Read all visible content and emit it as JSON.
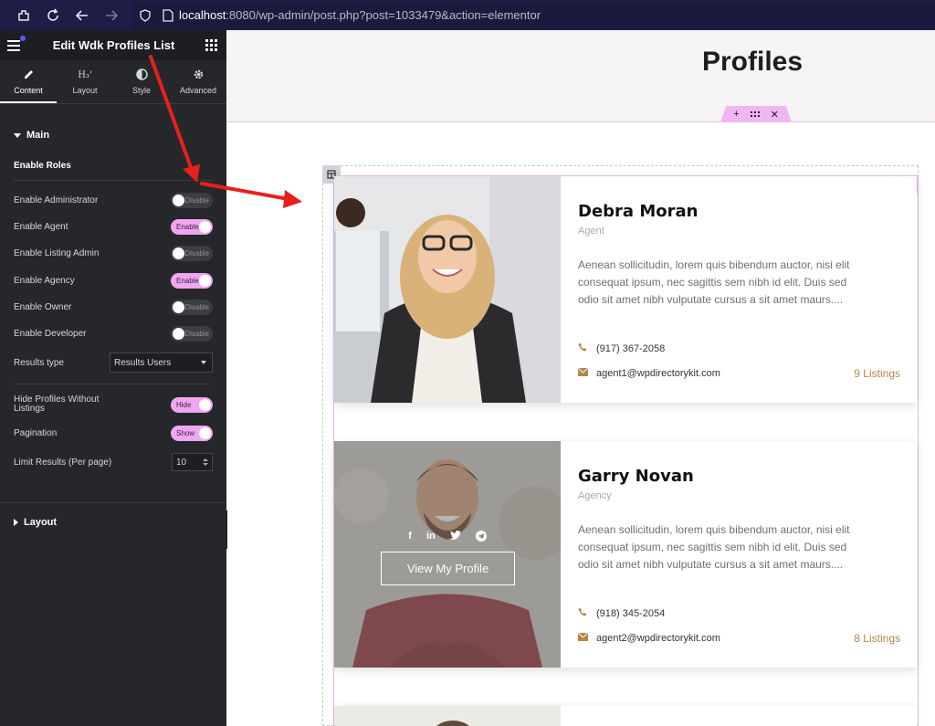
{
  "browser": {
    "url_host": "localhost",
    "url_rest": ":8080/wp-admin/post.php?post=1033479&action=elementor"
  },
  "sidebar": {
    "title": "Edit Wdk Profiles List",
    "tabs": [
      {
        "label": "Content",
        "icon": "pencil-icon"
      },
      {
        "label": "Layout",
        "icon": "layout-icon"
      },
      {
        "label": "Style",
        "icon": "contrast-icon"
      },
      {
        "label": "Advanced",
        "icon": "gear-icon"
      }
    ],
    "layout_tab_glyph": "H₃'",
    "main_section": "Main",
    "enable_roles_heading": "Enable Roles",
    "roles": [
      {
        "label": "Enable Administrator",
        "state": "Disable"
      },
      {
        "label": "Enable Agent",
        "state": "Enable"
      },
      {
        "label": "Enable Listing Admin",
        "state": "Disable"
      },
      {
        "label": "Enable Agency",
        "state": "Enable"
      },
      {
        "label": "Enable Owner",
        "state": "Disable"
      },
      {
        "label": "Enable Developer",
        "state": "Disable"
      }
    ],
    "results_type": {
      "label": "Results type",
      "value": "Results Users"
    },
    "hide_profiles": {
      "label_line1": "Hide Profiles Without",
      "label_line2": "Listings",
      "state": "Hide"
    },
    "pagination": {
      "label": "Pagination",
      "state": "Show"
    },
    "limit_results": {
      "label": "Limit Results (Per page)",
      "value": "10"
    },
    "layout_section": "Layout"
  },
  "canvas": {
    "page_title": "Profiles",
    "profiles": [
      {
        "name": "Debra Moran",
        "role": "Agent",
        "description": "Aenean sollicitudin, lorem quis bibendum auctor, nisi elit consequat ipsum, nec sagittis sem nibh id elit. Duis sed odio sit amet nibh vulputate cursus a sit amet maurs....",
        "phone": "(917) 367-2058",
        "email": "agent1@wpdirectorykit.com",
        "listings": "9 Listings"
      },
      {
        "name": "Garry Novan",
        "role": "Agency",
        "description": "Aenean sollicitudin, lorem quis bibendum auctor, nisi elit consequat ipsum, nec sagittis sem nibh id elit. Duis sed odio sit amet nibh vulputate cursus a sit amet maurs....",
        "phone": "(918) 345-2054",
        "email": "agent2@wpdirectorykit.com",
        "listings": "8 Listings",
        "button": "View My Profile",
        "social": [
          "f",
          "in",
          "twitter-icon",
          "telegram-icon"
        ]
      }
    ]
  },
  "colors": {
    "toggle_on": "#f0a7f2",
    "accent_gold": "#b3874a",
    "annotation_arrow": "#e8201c",
    "browser_bar": "#1f1d45"
  }
}
